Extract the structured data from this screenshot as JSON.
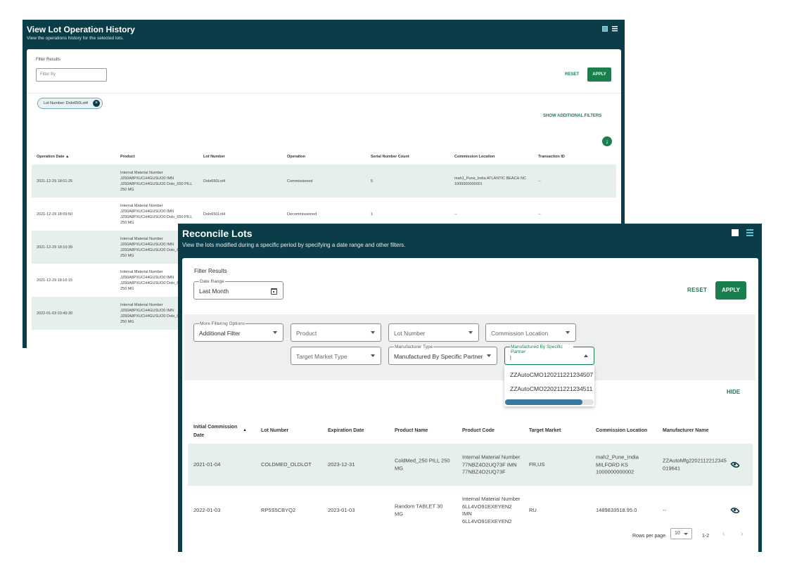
{
  "history": {
    "title": "View Lot Operation History",
    "subtitle": "View the operations history for the selected lots.",
    "filter_results_label": "Filter Results",
    "filter_placeholder": "Filter By",
    "reset_label": "RESET",
    "apply_label": "APPLY",
    "chip_label": "Lot Number: Dolo650Lot4",
    "show_more_label": "SHOW ADDITIONAL FILTERS",
    "columns": [
      "Operation Date ▲",
      "Product",
      "Lot Number",
      "Operation",
      "Serial Number Count",
      "Commission Location",
      "Transaction ID"
    ],
    "rows": [
      {
        "date": "2021-12-29 18:01:25",
        "product": "Internal Material Number JZ60A8PXUCH4GUSUO0 IMN JZ60A8PXUCH4GUSUO0 Dolo_650 PILL 250 MG",
        "lot": "Dolo650Lot4",
        "operation": "Commissioned",
        "count": "5",
        "location": "mah1_Pune_India ATLANTIC BEACH NC 1000000000001",
        "txn": "--"
      },
      {
        "date": "2021-12-29 18:09:50",
        "product": "Internal Material Number JZ60A8PXUCH4GUSUO0 IMN JZ60A8PXUCH4GUSUO0 Dolo_650 PILL 250 MG",
        "lot": "Dolo650Lot4",
        "operation": "Decommissioned",
        "count": "1",
        "location": "--",
        "txn": "--"
      },
      {
        "date": "2021-12-29 18:10:39",
        "product": "Internal Material Number JZ60A8PXUCH4GUSUO0 IMN JZ60A8PXUCH4GUSUO0 Dolo_650 PILL 250 MG",
        "lot": "",
        "operation": "",
        "count": "",
        "location": "",
        "txn": ""
      },
      {
        "date": "2021-12-29 18:16:15",
        "product": "Internal Material Number JZ60A8PXUCH4GUSUO0 IMN JZ60A8PXUCH4GUSUO0 Dolo_650 PILL 250 MG",
        "lot": "",
        "operation": "",
        "count": "",
        "location": "",
        "txn": ""
      },
      {
        "date": "2022-01-03 03:49:30",
        "product": "Internal Material Number JZ60A8PXUCH4GUSUO0 IMN JZ60A8PXUCH4GUSUO0 Dolo_650 PILL 250 MG",
        "lot": "",
        "operation": "",
        "count": "",
        "location": "",
        "txn": ""
      }
    ]
  },
  "reconcile": {
    "title": "Reconcile Lots",
    "subtitle": "View the lots modified during a specific period by specifying a date range and other filters.",
    "filter_results_label": "Filter Results",
    "date_range": {
      "label": "Date Range",
      "value": "Last Month"
    },
    "reset_label": "RESET",
    "apply_label": "APPLY",
    "filters": {
      "more_options": {
        "label": "More Filtering Options",
        "value": "Additional Filter"
      },
      "product": "Product",
      "lot_number": "Lot Number",
      "commission_location": "Commission Location",
      "target_market_type": "Target Market Type",
      "manufacturer_type": {
        "label": "Manufacturer Type",
        "value": "Manufactured By Specific Partner"
      },
      "manufactured_by": {
        "label": "Manufactured By Specific Partner",
        "value": "|"
      }
    },
    "dropdown_options": [
      "ZZAutoCMO120211221234507",
      "ZZAutoCMO220211221234511"
    ],
    "hide_label": "HIDE",
    "columns": {
      "initial_commission_date": "Initial Commission Date",
      "lot_number": "Lot Number",
      "expiration_date": "Expiration Date",
      "product_name": "Product Name",
      "product_code": "Product Code",
      "target_market": "Target Market",
      "commission_location": "Commission Location",
      "manufacturer_name": "Manufacturer Name"
    },
    "rows": [
      {
        "date": "2021-01-04",
        "lot": "COLDMED_OLDLOT",
        "expiry": "2023-12-31",
        "product": "ColdMed_250 PILL 250 MG",
        "code": "Internal Material Number 77NBZ4O2UQ73F IMN 77NBZ4O2UQ73F",
        "market": "FR,US",
        "location": "mah2_Pune_India MILFORD KS 1000000000002",
        "manufacturer": "ZZAutoMfg2202112212345019641"
      },
      {
        "date": "2022-01-03",
        "lot": "RP5S5CBYQ2",
        "expiry": "2023-01-03",
        "product": "Random TABLET 30 MG",
        "code": "Internal Material Number 6LL4VO91EXEYEN2 IMN 6LL4VO91EXEYEN2",
        "market": "RU",
        "location": "1489833518.95.0",
        "manufacturer": "--"
      }
    ],
    "pagination": {
      "rows_per_page_label": "Rows per page",
      "rows_per_page": "10",
      "range": "1-2"
    }
  },
  "colors": {
    "header": "#0b3d48",
    "accent": "#1a7f4d",
    "row_shade": "#e6efeb"
  },
  "icons": [
    "chart-view-icon",
    "list-view-icon",
    "download-icon",
    "close-chip-icon",
    "calendar-icon",
    "eye-icon",
    "chevron-left-icon",
    "chevron-right-icon"
  ]
}
